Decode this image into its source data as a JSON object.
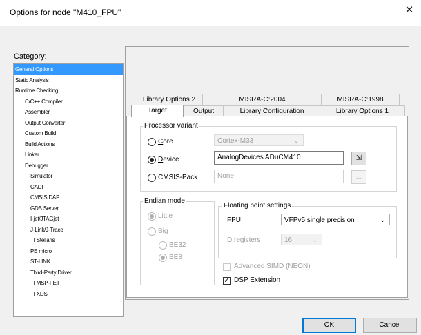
{
  "window": {
    "title": "Options for node \"M410_FPU\"",
    "close_glyph": "✕"
  },
  "category": {
    "label": "Category:",
    "items": [
      {
        "label": "General Options",
        "level": 0,
        "selected": true
      },
      {
        "label": "Static Analysis",
        "level": 0
      },
      {
        "label": "Runtime Checking",
        "level": 0
      },
      {
        "label": "C/C++ Compiler",
        "level": 1
      },
      {
        "label": "Assembler",
        "level": 1
      },
      {
        "label": "Output Converter",
        "level": 1
      },
      {
        "label": "Custom Build",
        "level": 1
      },
      {
        "label": "Build Actions",
        "level": 1
      },
      {
        "label": "Linker",
        "level": 1
      },
      {
        "label": "Debugger",
        "level": 1
      },
      {
        "label": "Simulator",
        "level": 2
      },
      {
        "label": "CADI",
        "level": 2
      },
      {
        "label": "CMSIS DAP",
        "level": 2
      },
      {
        "label": "GDB Server",
        "level": 2
      },
      {
        "label": "I-jet/JTAGjet",
        "level": 2
      },
      {
        "label": "J-Link/J-Trace",
        "level": 2
      },
      {
        "label": "TI Stellaris",
        "level": 2
      },
      {
        "label": "PE micro",
        "level": 2
      },
      {
        "label": "ST-LINK",
        "level": 2
      },
      {
        "label": "Third-Party Driver",
        "level": 2
      },
      {
        "label": "TI MSP-FET",
        "level": 2
      },
      {
        "label": "TI XDS",
        "level": 2
      }
    ]
  },
  "tabs": {
    "row_back": [
      "Library Options 2",
      "MISRA-C:2004",
      "MISRA-C:1998"
    ],
    "row_front": [
      "Target",
      "Output",
      "Library Configuration",
      "Library Options 1"
    ],
    "active": "Target"
  },
  "processor": {
    "group_label": "Processor variant",
    "core_label": "Core",
    "core_value": "Cortex-M33",
    "device_label": "Device",
    "device_value": "AnalogDevices ADuCM410",
    "device_button_glyph": "⇲",
    "cmsis_label": "CMSIS-Pack",
    "cmsis_value": "None",
    "cmsis_button": "...",
    "selected": "device"
  },
  "endian": {
    "group_label": "Endian mode",
    "little_label": "Little",
    "big_label": "Big",
    "be32_label": "BE32",
    "be8_label": "BE8",
    "selected": "little",
    "big_sub_selected": "be8"
  },
  "fpu": {
    "group_label": "Floating point settings",
    "fpu_label": "FPU",
    "fpu_value": "VFPv5 single precision",
    "dreg_label": "D registers",
    "dreg_value": "16",
    "simd_label": "Advanced SIMD (NEON)",
    "simd_checked": false,
    "dsp_label": "DSP Extension",
    "dsp_checked": true
  },
  "buttons": {
    "ok": "OK",
    "cancel": "Cancel"
  }
}
